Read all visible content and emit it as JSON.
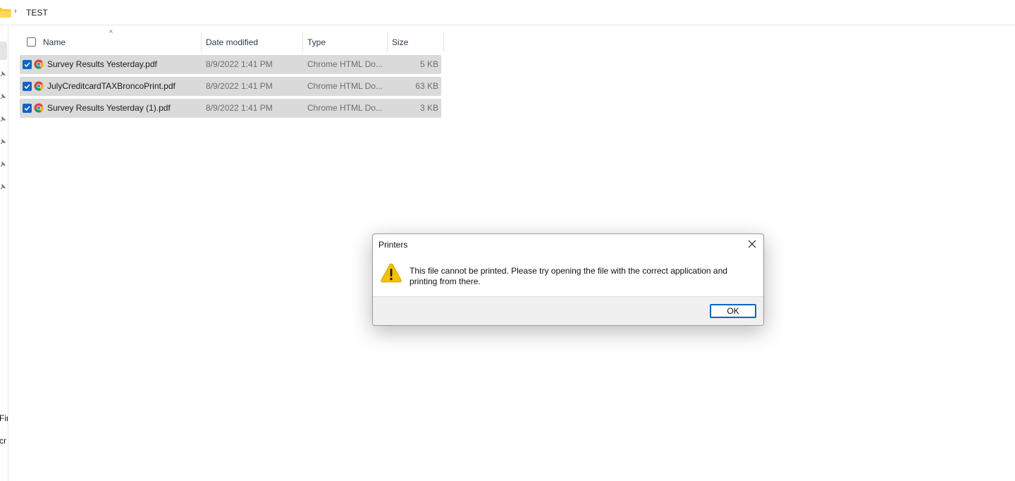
{
  "addressbar": {
    "separator": "›",
    "crumb": "TEST"
  },
  "navpane": {
    "items": [
      "Fir",
      "cr"
    ]
  },
  "columns": {
    "name": "Name",
    "date": "Date modified",
    "type": "Type",
    "size": "Size",
    "sort_indicator": "^"
  },
  "files": [
    {
      "name": "Survey Results Yesterday.pdf",
      "date": "8/9/2022 1:41 PM",
      "type": "Chrome HTML Do...",
      "size": "5 KB",
      "selected": true
    },
    {
      "name": "JulyCreditcardTAXBroncoPrint.pdf",
      "date": "8/9/2022 1:41 PM",
      "type": "Chrome HTML Do...",
      "size": "63 KB",
      "selected": true
    },
    {
      "name": "Survey Results Yesterday (1).pdf",
      "date": "8/9/2022 1:41 PM",
      "type": "Chrome HTML Do...",
      "size": "3 KB",
      "selected": true
    }
  ],
  "dialog": {
    "title": "Printers",
    "message": "This file cannot be printed. Please try opening the file with the correct application and printing from there.",
    "ok_label": "OK",
    "icon": "warning-icon"
  },
  "colors": {
    "accent": "#0067c0",
    "selection": "#dadada",
    "warning": "#f5c000"
  }
}
